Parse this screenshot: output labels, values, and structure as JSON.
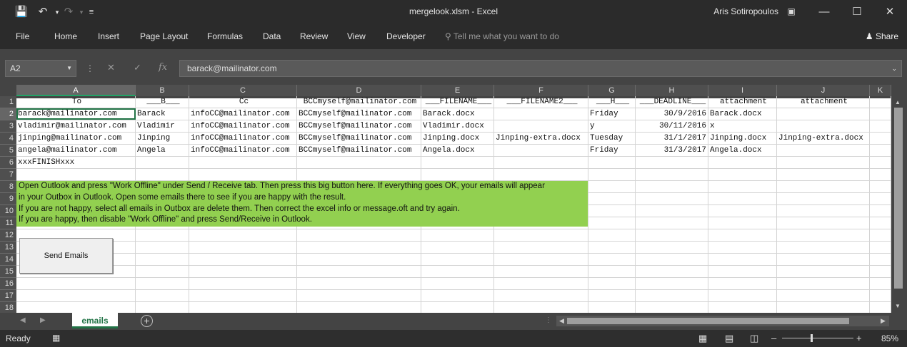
{
  "window": {
    "title": "mergelook.xlsm - Excel",
    "user": "Aris Sotiropoulos",
    "quick_access": {
      "save_icon": "save-icon",
      "undo_icon": "undo-icon",
      "redo_icon": "redo-icon"
    }
  },
  "ribbon": {
    "tabs": [
      "File",
      "Home",
      "Insert",
      "Page Layout",
      "Formulas",
      "Data",
      "Review",
      "View",
      "Developer"
    ],
    "tell_me": "Tell me what you want to do",
    "share": "Share"
  },
  "formula_bar": {
    "name_box": "A2",
    "fx": "fx",
    "value": "barack@mailinator.com"
  },
  "columns": [
    "A",
    "B",
    "C",
    "D",
    "E",
    "F",
    "G",
    "H",
    "I",
    "J",
    "K"
  ],
  "rows": [
    "1",
    "2",
    "3",
    "4",
    "5",
    "6",
    "7",
    "8",
    "9",
    "10",
    "11",
    "12",
    "13",
    "14",
    "15",
    "16",
    "17",
    "18"
  ],
  "table": {
    "header": [
      "To",
      "___B___",
      "Cc",
      "BCCmyself@mailinator.com",
      "___FILENAME___",
      "___FILENAME2___",
      "___H___",
      "___DEADLINE___",
      "attachment",
      "attachment"
    ],
    "rows": [
      [
        "barack@mailinator.com",
        "Barack",
        "infoCC@mailinator.com",
        "BCCmyself@mailinator.com",
        "Barack.docx",
        "",
        "Friday",
        "30/9/2016",
        "Barack.docx",
        ""
      ],
      [
        "vladimir@mailinator.com",
        "Vladimir",
        "infoCC@mailinator.com",
        "BCCmyself@mailinator.com",
        "Vladimir.docx",
        "",
        "y",
        "30/11/2016",
        "x",
        ""
      ],
      [
        "jinping@mailinator.com",
        "Jinping",
        "infoCC@mailinator.com",
        "BCCmyself@mailinator.com",
        "Jinping.docx",
        "Jinping-extra.docx",
        "Tuesday",
        "31/1/2017",
        "Jinping.docx",
        "Jinping-extra.docx"
      ],
      [
        "angela@mailinator.com",
        "Angela",
        "infoCC@mailinator.com",
        "BCCmyself@mailinator.com",
        "Angela.docx",
        "",
        "Friday",
        "31/3/2017",
        "Angela.docx",
        ""
      ]
    ],
    "finish": "xxxFINISHxxx"
  },
  "instructions": [
    "Open Outlook and press \"Work Offline\" under Send / Receive tab. Then press this big button here. If everything goes OK, your emails will appear",
    "in your Outbox in Outlook. Open some emails there to see if you are happy with the result.",
    "If you are not happy, select all emails in Outbox are delete them. Then correct the excel info or message.oft and try again.",
    "If you are happy, then disable \"Work Offline\" and press Send/Receive in Outlook."
  ],
  "send_button": "Send Emails",
  "sheet_tabs": {
    "active": "emails"
  },
  "status": {
    "ready": "Ready",
    "zoom": "85%"
  },
  "colors": {
    "accent": "#217346",
    "highlight": "#92d050",
    "chrome": "#2b2b2b"
  }
}
